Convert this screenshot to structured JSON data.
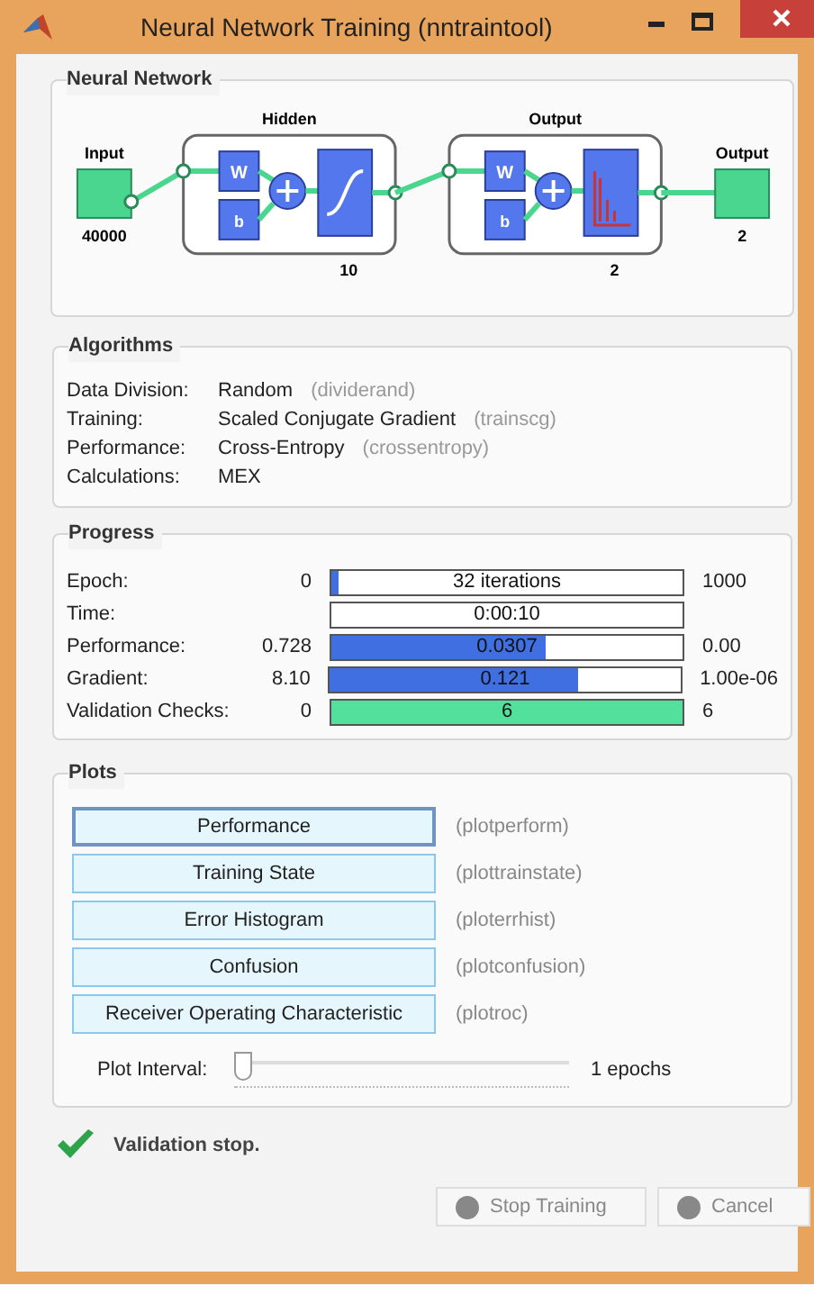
{
  "window": {
    "title": "Neural Network Training (nntraintool)"
  },
  "neural_network": {
    "title": "Neural Network",
    "input": {
      "label": "Input",
      "size": "40000"
    },
    "hidden": {
      "label": "Hidden",
      "size": "10",
      "w": "W",
      "b": "b"
    },
    "output_layer": {
      "label": "Output",
      "size": "2",
      "w": "W",
      "b": "b"
    },
    "output": {
      "label": "Output",
      "size": "2"
    }
  },
  "algorithms": {
    "title": "Algorithms",
    "rows": [
      {
        "label": "Data Division:",
        "value": "Random",
        "function": "(dividerand)"
      },
      {
        "label": "Training:",
        "value": "Scaled Conjugate Gradient",
        "function": "(trainscg)"
      },
      {
        "label": "Performance:",
        "value": "Cross-Entropy",
        "function": "(crossentropy)"
      },
      {
        "label": "Calculations:",
        "value": "MEX"
      }
    ]
  },
  "progress": {
    "title": "Progress",
    "rows": [
      {
        "label": "Epoch:",
        "start": "0",
        "reading": "32 iterations",
        "end": "1000",
        "level": 0.02,
        "color": "#3f6fe0"
      },
      {
        "label": "Time:",
        "reading": "0:00:10"
      },
      {
        "label": "Performance:",
        "start": "0.728",
        "reading": "0.0307",
        "end": "0.00",
        "level": 0.61,
        "color": "#3f6fe0"
      },
      {
        "label": "Gradient:",
        "start": "8.10",
        "reading": "0.121",
        "end": "1.00e-06",
        "level": 0.71,
        "color": "#3f6fe0"
      },
      {
        "label": "Validation Checks:",
        "start": "0",
        "reading": "6",
        "end": "6",
        "level": 1,
        "color": "#52e09c"
      }
    ]
  },
  "plots": {
    "title": "Plots",
    "buttons": [
      {
        "label": "Performance",
        "function": "(plotperform)",
        "selected": true
      },
      {
        "label": "Training State",
        "function": "(plottrainstate)",
        "selected": false
      },
      {
        "label": "Error Histogram",
        "function": "(ploterrhist)",
        "selected": false
      },
      {
        "label": "Confusion",
        "function": "(plotconfusion)",
        "selected": false
      },
      {
        "label": "Receiver Operating Characteristic",
        "function": "(plotroc)",
        "selected": false
      }
    ],
    "interval": {
      "label": "Plot Interval:",
      "level": 0,
      "reading": "1 epochs"
    }
  },
  "status": "Validation stop.",
  "buttons": [
    {
      "label": "Stop Training",
      "disabled": true
    },
    {
      "label": "Cancel",
      "disabled": true
    }
  ]
}
